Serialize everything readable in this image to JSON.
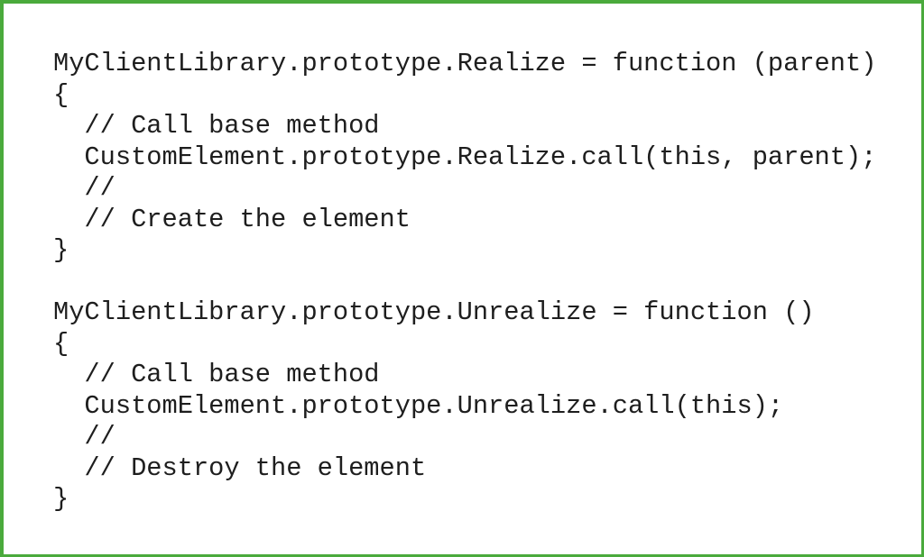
{
  "colors": {
    "border": "#4aaa3c",
    "background": "#ffffff",
    "text": "#1e1e1e"
  },
  "code": {
    "language": "javascript",
    "lines": [
      "MyClientLibrary.prototype.Realize = function (parent)",
      "{",
      "  // Call base method",
      "  CustomElement.prototype.Realize.call(this, parent);",
      "  //",
      "  // Create the element",
      "}",
      "",
      "MyClientLibrary.prototype.Unrealize = function ()",
      "{",
      "  // Call base method",
      "  CustomElement.prototype.Unrealize.call(this);",
      "  //",
      "  // Destroy the element",
      "}"
    ]
  }
}
